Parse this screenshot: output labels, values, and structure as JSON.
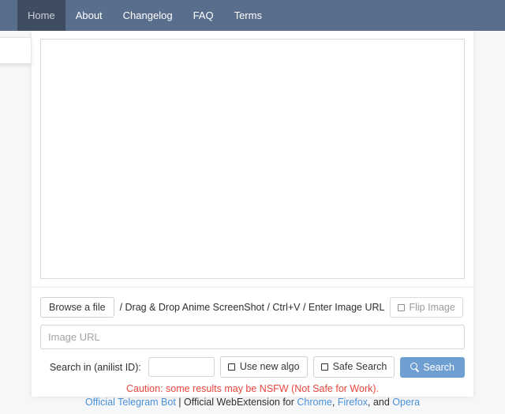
{
  "navbar": {
    "background_color": "#596d8c",
    "active_color": "#3f4d63",
    "items": [
      {
        "label": "Home",
        "active": true
      },
      {
        "label": "About",
        "active": false
      },
      {
        "label": "Changelog",
        "active": false
      },
      {
        "label": "FAQ",
        "active": false
      },
      {
        "label": "Terms",
        "active": false
      }
    ]
  },
  "preview": {
    "content": ""
  },
  "form": {
    "browse_button": "Browse a file",
    "hint": "/ Drag & Drop Anime ScreenShot / Ctrl+V / Enter Image URL",
    "flip_image_label": "Flip Image",
    "flip_icon": "checkbox-unchecked-icon",
    "url_placeholder": "Image URL",
    "url_value": "",
    "anilist_label": "Search in (anilist ID):",
    "anilist_placeholder": "",
    "anilist_value": "",
    "new_algo_label": "Use new algo",
    "new_algo_icon": "checkbox-unchecked-icon",
    "safe_search_label": "Safe Search",
    "safe_search_icon": "checkbox-unchecked-icon",
    "search_button": "Search",
    "search_icon": "magnifier-icon",
    "search_button_color": "#6f9fd0"
  },
  "notices": {
    "caution": "Caution: some results may be NSFW (Not Safe for Work).",
    "caution_color": "#e8453c",
    "footer": {
      "telegram_link": "Official Telegram Bot",
      "separator": " | ",
      "webextension_text": "Official WebExtension for ",
      "chrome_link": "Chrome",
      "comma_1": ", ",
      "firefox_link": "Firefox",
      "comma_2": ", and ",
      "opera_link": "Opera",
      "link_color": "#4a90d9"
    }
  }
}
